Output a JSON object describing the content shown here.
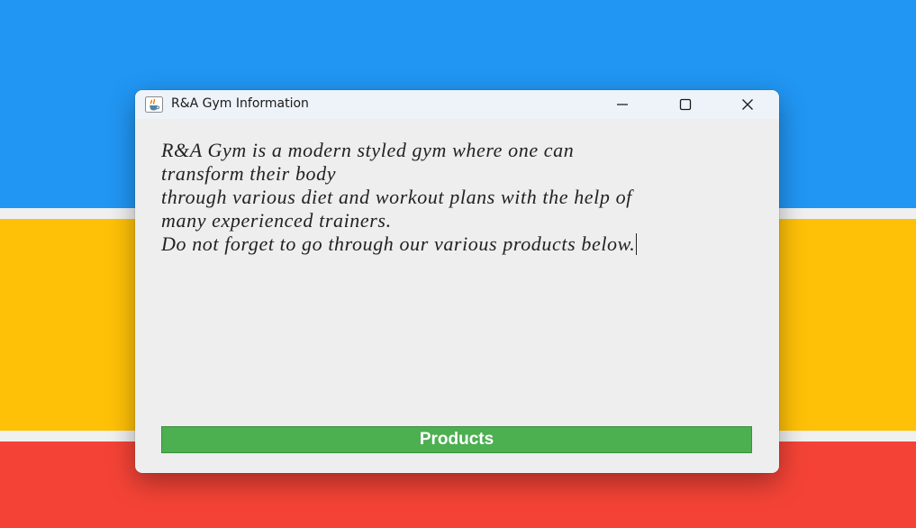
{
  "colors": {
    "band_blue": "#2196f3",
    "band_yellow": "#ffc107",
    "band_red": "#f44336",
    "window_background": "#eeeeee",
    "button_green": "#4caf50"
  },
  "window": {
    "title": "R&A Gym Information",
    "icon": "java-cup-icon",
    "controls": {
      "minimize_icon": "minimize-icon",
      "maximize_icon": "maximize-icon",
      "close_icon": "close-icon"
    }
  },
  "info_text": {
    "lines": [
      "R&A Gym is a modern styled gym where one can",
      "transform their body",
      "through various diet and workout plans with the help of",
      "many experienced trainers.",
      "Do not forget to go through our various products below."
    ]
  },
  "products_button": {
    "label": "Products"
  }
}
